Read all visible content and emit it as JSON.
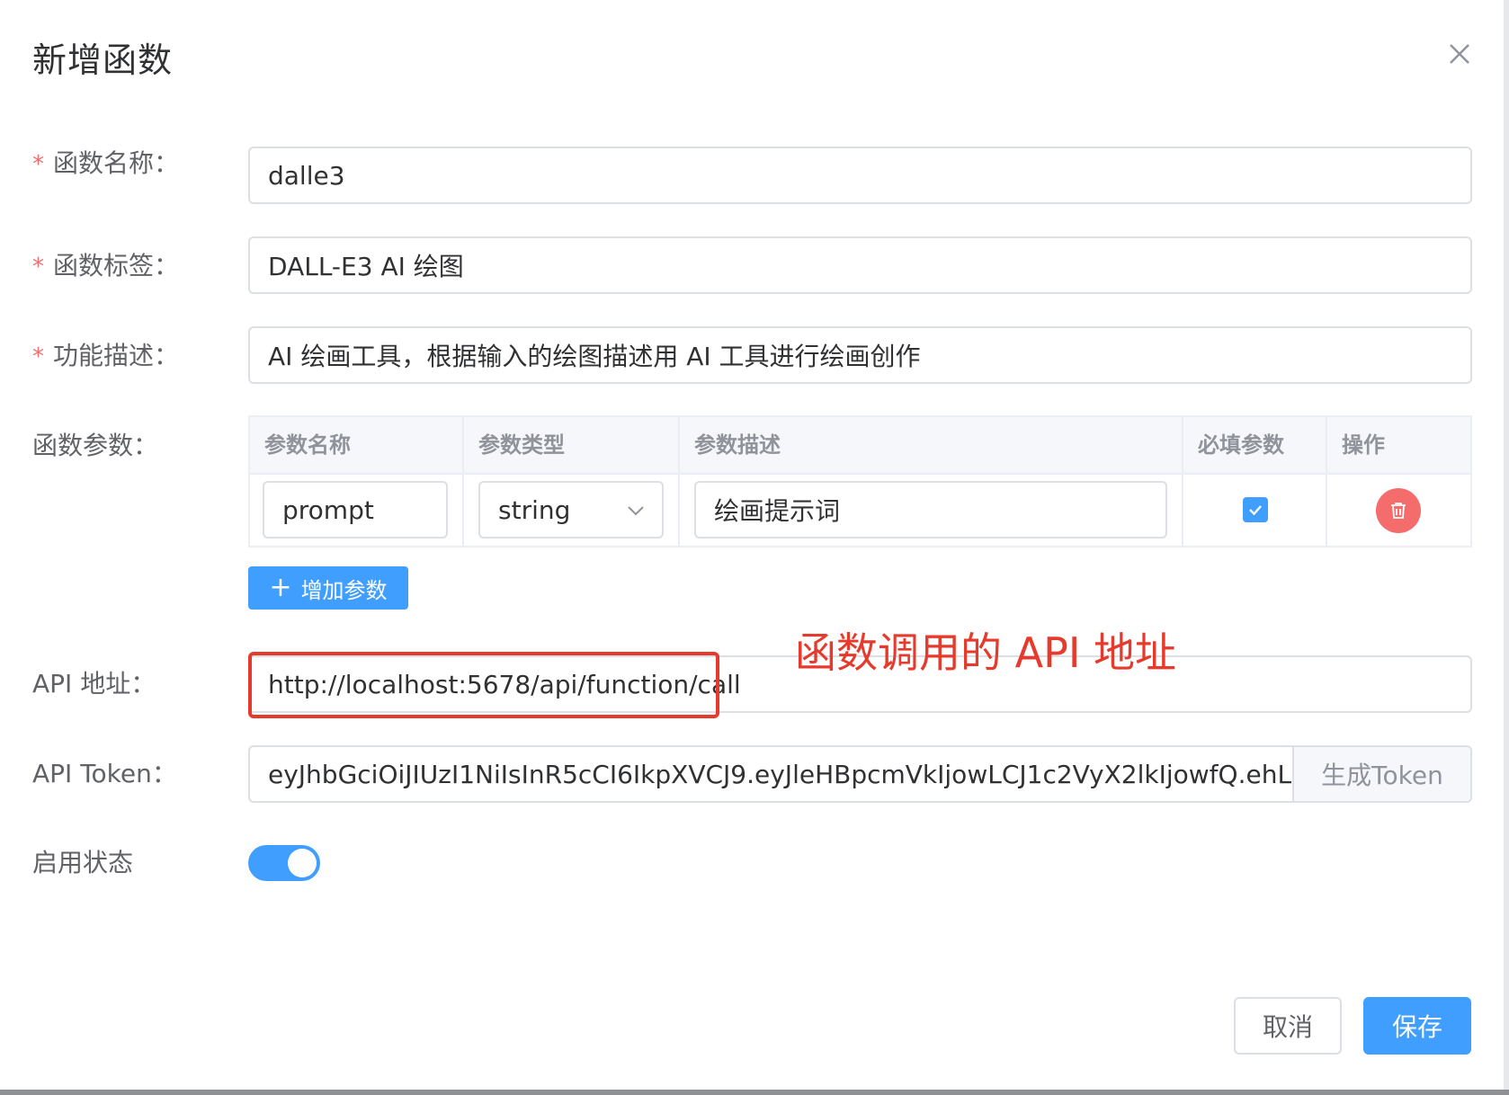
{
  "dialog": {
    "title": "新增函数",
    "close_icon": "close-icon"
  },
  "form": {
    "name": {
      "label": "函数名称：",
      "required_mark": "*",
      "value": "dalle3"
    },
    "tag": {
      "label": "函数标签：",
      "required_mark": "*",
      "value": "DALL-E3 AI 绘图"
    },
    "description": {
      "label": "功能描述：",
      "required_mark": "*",
      "value": "AI 绘画工具，根据输入的绘图描述用 AI 工具进行绘画创作"
    },
    "params": {
      "label": "函数参数：",
      "columns": [
        "参数名称",
        "参数类型",
        "参数描述",
        "必填参数",
        "操作"
      ],
      "rows": [
        {
          "name": "prompt",
          "type": "string",
          "description": "绘画提示词",
          "required": true
        }
      ],
      "add_button": "增加参数"
    },
    "api_url": {
      "label": "API 地址：",
      "value": "http://localhost:5678/api/function/call"
    },
    "api_token": {
      "label": "API Token：",
      "value": "eyJhbGciOiJIUzI1NiIsInR5cCI6IkpXVCJ9.eyJleHBpcmVkIjowLCJ1c2VyX2lkIjowfQ.ehLClX",
      "generate_button": "生成Token"
    },
    "enabled": {
      "label": "启用状态",
      "value": true
    }
  },
  "annotation": {
    "text": "函数调用的 API 地址",
    "color": "#e53a2c"
  },
  "footer": {
    "cancel_label": "取消",
    "save_label": "保存"
  },
  "colors": {
    "primary": "#409eff",
    "danger": "#f56c6c",
    "annotation": "#e53a2c"
  }
}
